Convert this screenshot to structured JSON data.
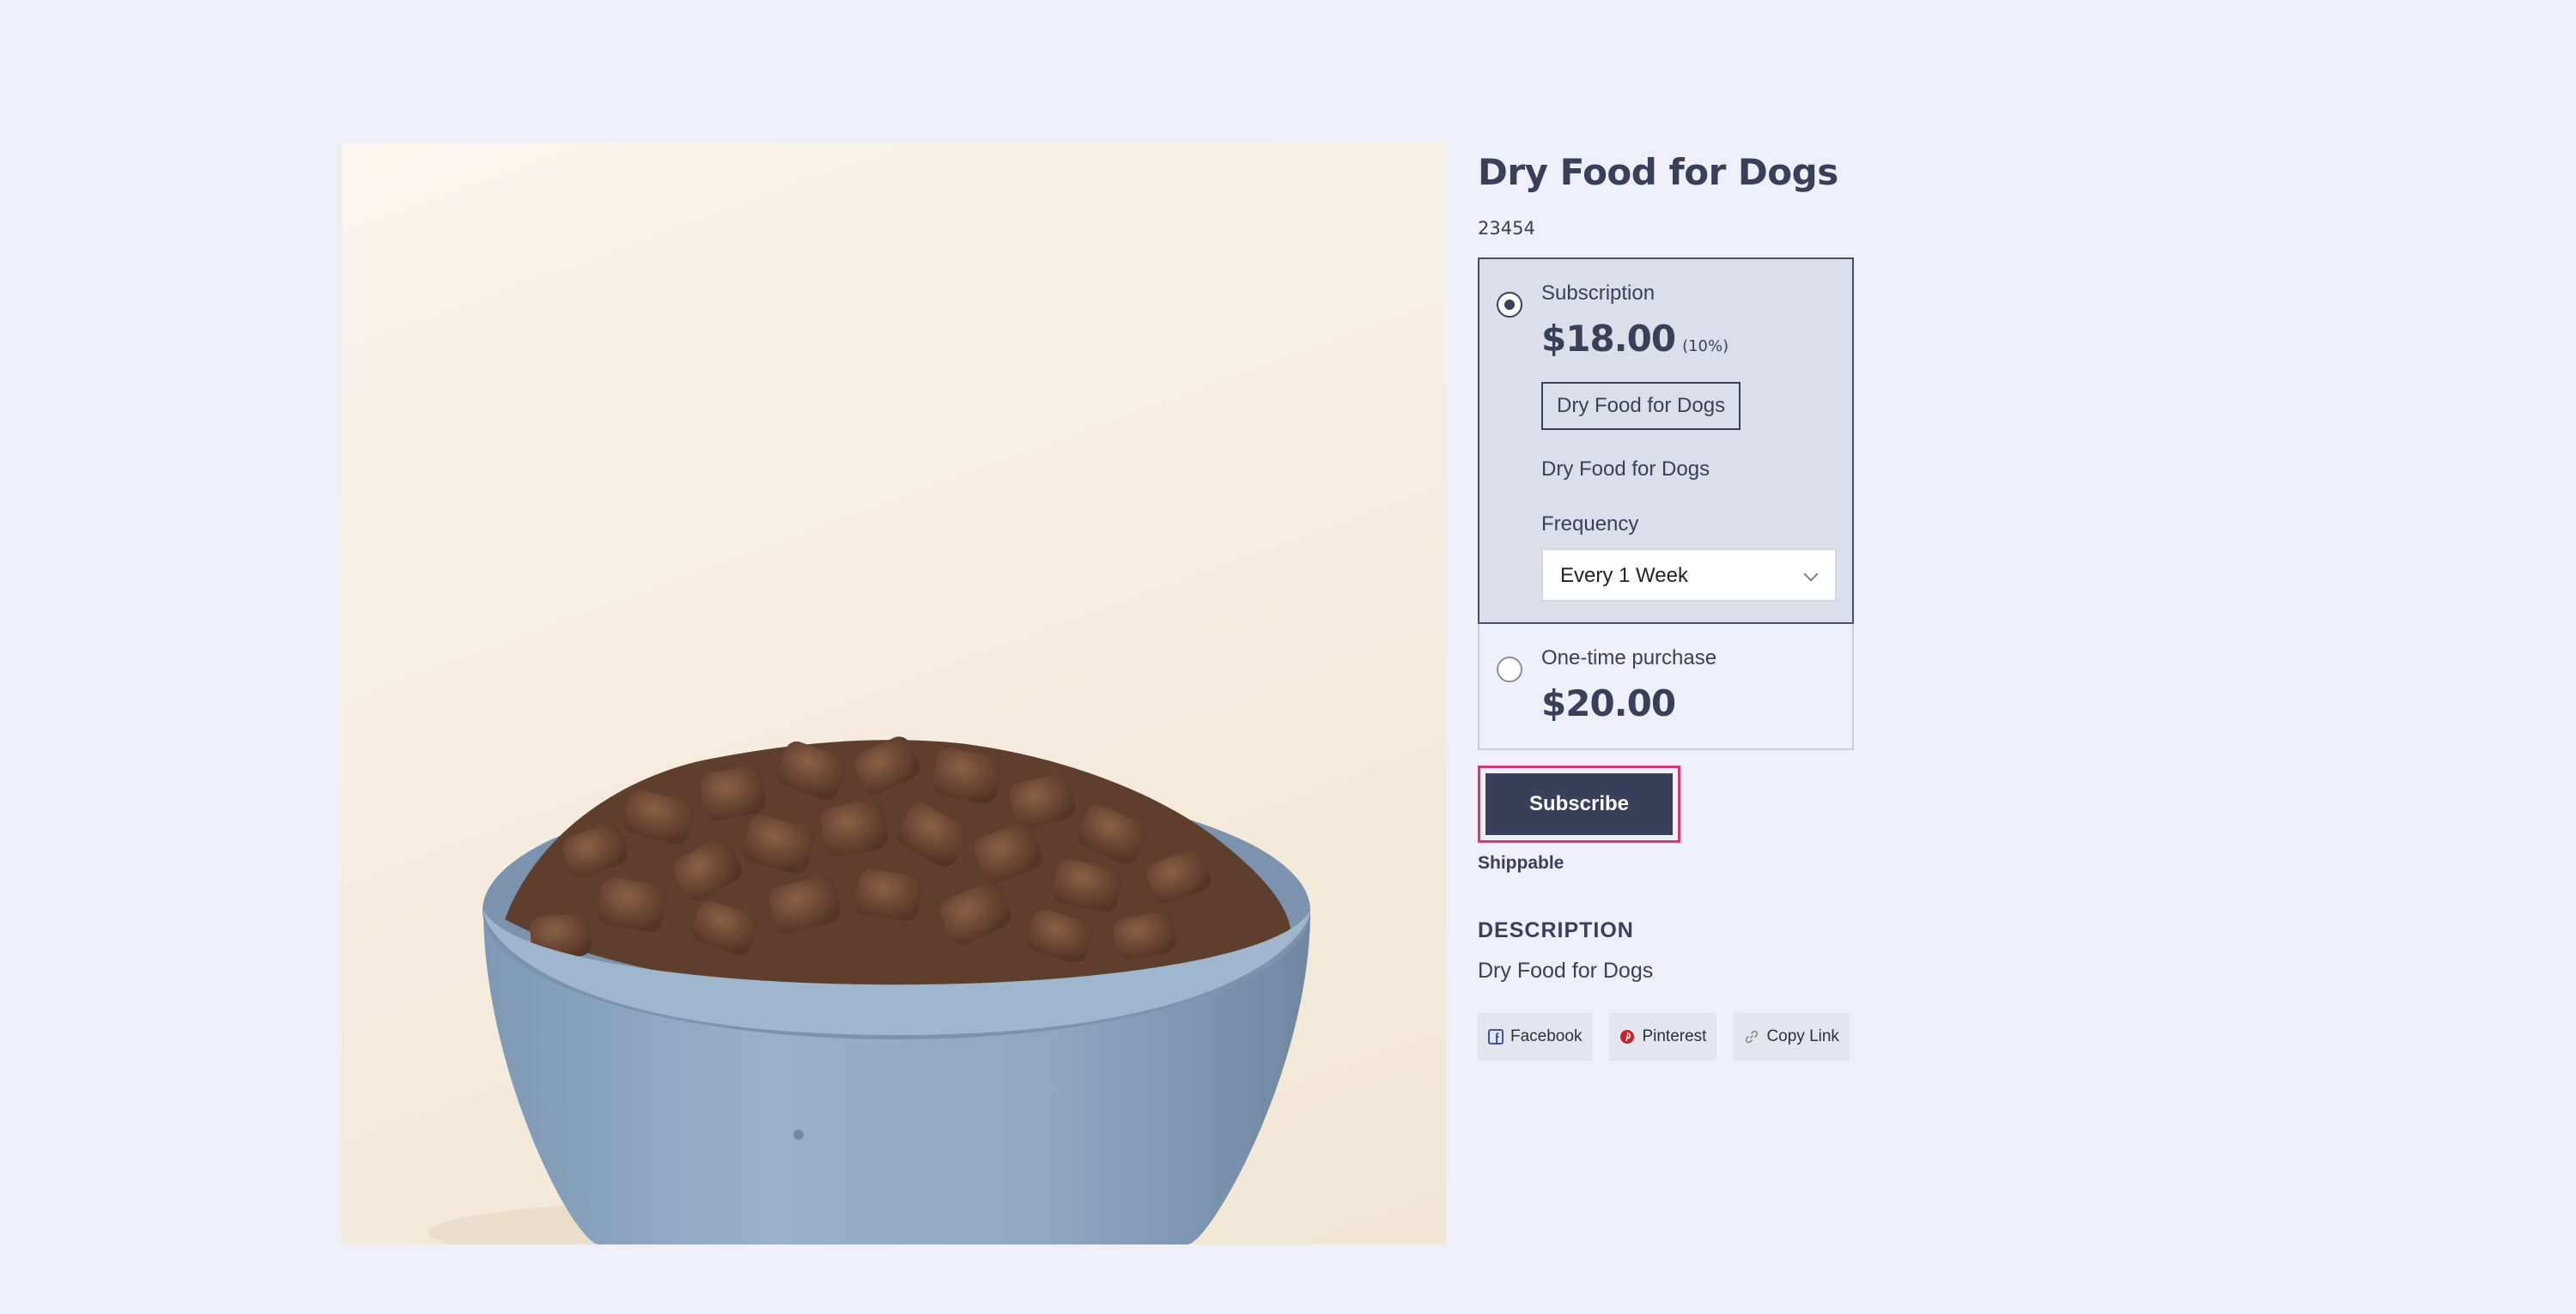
{
  "product": {
    "title": "Dry Food for Dogs",
    "sku": "23454",
    "image_alt": "Bowl of dry dog food kibble"
  },
  "purchase_options": {
    "subscription": {
      "label": "Subscription",
      "price": "$18.00",
      "discount": "(10%)",
      "variant_button": "Dry Food for Dogs",
      "variant_text": "Dry Food for Dogs",
      "frequency_label": "Frequency",
      "frequency_value": "Every 1 Week",
      "selected": true
    },
    "one_time": {
      "label": "One-time purchase",
      "price": "$20.00",
      "selected": false
    }
  },
  "actions": {
    "subscribe_label": "Subscribe",
    "shippable_label": "Shippable"
  },
  "description": {
    "heading": "DESCRIPTION",
    "text": "Dry Food for Dogs"
  },
  "share": {
    "facebook": "Facebook",
    "pinterest": "Pinterest",
    "copy_link": "Copy Link"
  },
  "colors": {
    "background": "#eeeff8",
    "primary": "#3a3f5a",
    "focus_outline": "#e0336f",
    "selected_option_bg": "#dcdfe9"
  }
}
